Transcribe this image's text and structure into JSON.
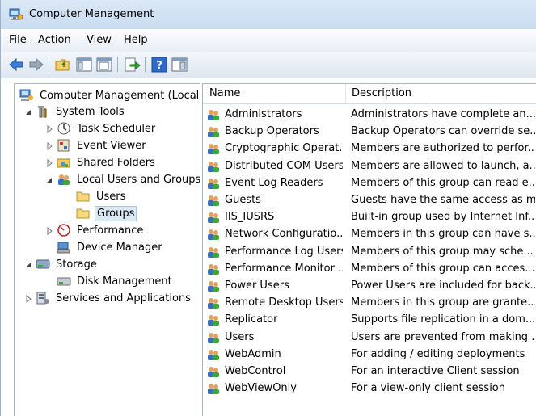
{
  "window": {
    "title": "Computer Management"
  },
  "menu": {
    "items": [
      {
        "label": "File"
      },
      {
        "label": "Action"
      },
      {
        "label": "View"
      },
      {
        "label": "Help"
      }
    ]
  },
  "toolbar": {
    "buttons": [
      "back-arrow-icon",
      "forward-arrow-icon",
      "up-folder-icon",
      "show-hide-tree-icon",
      "export-list-icon",
      "help-icon",
      "show-hide-action-pane-icon"
    ]
  },
  "tree": {
    "items": [
      {
        "label": "Computer Management (Local",
        "icon": "computer-management-icon",
        "expander": "none"
      },
      {
        "label": "System Tools",
        "icon": "tools-icon",
        "expander": "expanded"
      },
      {
        "label": "Task Scheduler",
        "icon": "clock-icon",
        "expander": "collapsed"
      },
      {
        "label": "Event Viewer",
        "icon": "event-viewer-icon",
        "expander": "collapsed"
      },
      {
        "label": "Shared Folders",
        "icon": "shared-folder-icon",
        "expander": "collapsed"
      },
      {
        "label": "Local Users and Groups",
        "icon": "users-icon",
        "expander": "expanded"
      },
      {
        "label": "Users",
        "icon": "folder-icon",
        "expander": "none"
      },
      {
        "label": "Groups",
        "icon": "folder-icon",
        "expander": "none",
        "selected": true
      },
      {
        "label": "Performance",
        "icon": "performance-icon",
        "expander": "collapsed"
      },
      {
        "label": "Device Manager",
        "icon": "device-manager-icon",
        "expander": "none"
      },
      {
        "label": "Storage",
        "icon": "storage-icon",
        "expander": "expanded"
      },
      {
        "label": "Disk Management",
        "icon": "disk-icon",
        "expander": "none"
      },
      {
        "label": "Services and Applications",
        "icon": "services-icon",
        "expander": "collapsed"
      }
    ]
  },
  "list": {
    "columns": {
      "name": "Name",
      "description": "Description"
    },
    "rows": [
      {
        "name": "Administrators",
        "description": "Administrators have complete an..."
      },
      {
        "name": "Backup Operators",
        "description": "Backup Operators can override se..."
      },
      {
        "name": "Cryptographic Operat...",
        "description": "Members are authorized to perfor..."
      },
      {
        "name": "Distributed COM Users",
        "description": "Members are allowed to launch, a..."
      },
      {
        "name": "Event Log Readers",
        "description": "Members of this group can read e..."
      },
      {
        "name": "Guests",
        "description": "Guests have the same access as m..."
      },
      {
        "name": "IIS_IUSRS",
        "description": "Built-in group used by Internet Inf..."
      },
      {
        "name": "Network Configuratio...",
        "description": "Members in this group can have s..."
      },
      {
        "name": "Performance Log Users",
        "description": "Members of this group may sche..."
      },
      {
        "name": "Performance Monitor ...",
        "description": "Members of this group can acces..."
      },
      {
        "name": "Power Users",
        "description": "Power Users are included for back..."
      },
      {
        "name": "Remote Desktop Users",
        "description": "Members in this group are grante..."
      },
      {
        "name": "Replicator",
        "description": "Supports file replication in a dom..."
      },
      {
        "name": "Users",
        "description": "Users are prevented from making ..."
      },
      {
        "name": "WebAdmin",
        "description": "For adding / editing deployments"
      },
      {
        "name": "WebControl",
        "description": "For an interactive Client session"
      },
      {
        "name": "WebViewOnly",
        "description": "For a view-only client session"
      }
    ]
  }
}
